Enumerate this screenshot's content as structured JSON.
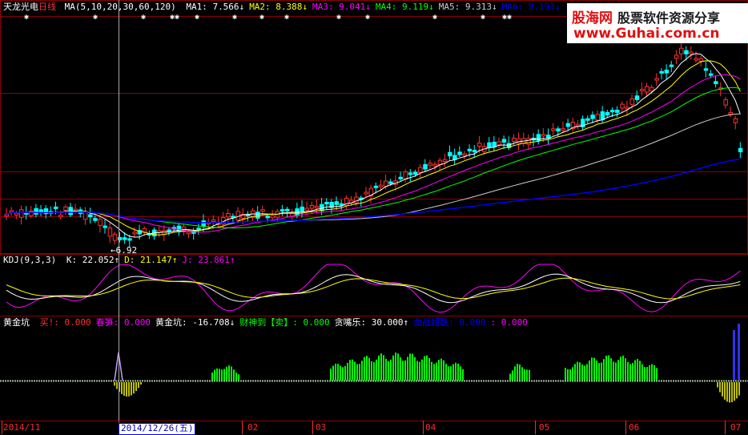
{
  "title": {
    "stock": "天龙光电",
    "period": "日线"
  },
  "ma_header": {
    "label": "MA(5,10,20,30,60,120)",
    "items": [
      {
        "name": "MA1",
        "value": "7.566",
        "arrow": "↓",
        "color": "#ffffff"
      },
      {
        "name": "MA2",
        "value": "8.388",
        "arrow": "↓",
        "color": "#ffff00"
      },
      {
        "name": "MA3",
        "value": "9.041",
        "arrow": "↓",
        "color": "#ff00ff"
      },
      {
        "name": "MA4",
        "value": "9.119",
        "arrow": "↓",
        "color": "#00ff00"
      },
      {
        "name": "MA5",
        "value": "9.313",
        "arrow": "↓",
        "color": "#cccccc"
      },
      {
        "name": "MA6",
        "value": "9.193",
        "arrow": "↓",
        "color": "#0000ff"
      }
    ]
  },
  "watermark": {
    "brand": "股海网",
    "tagline": "股票软件资源分享",
    "url": "www.Guhai.com.cn"
  },
  "low_marker": "6.92",
  "kdj_header": {
    "label": "KDJ(9,3,3)",
    "items": [
      {
        "name": "K",
        "value": "22.052",
        "arrow": "↑",
        "color": "#ffffff"
      },
      {
        "name": "D",
        "value": "21.147",
        "arrow": "↑",
        "color": "#ffff00"
      },
      {
        "name": "J",
        "value": "23.861",
        "arrow": "↑",
        "color": "#ff00ff"
      }
    ]
  },
  "gold_header": {
    "label": "黄金坑",
    "items": [
      {
        "name": "买!",
        "value": "0.000",
        "arrow": "",
        "color": "#ff3030"
      },
      {
        "name": "春笋",
        "value": "0.000",
        "arrow": "",
        "color": "#ff00ff"
      },
      {
        "name": "黄金坑",
        "value": "-16.708",
        "arrow": "↓",
        "color": "#ffffff"
      },
      {
        "name": "财神到【卖】",
        "value": "0.000",
        "arrow": "",
        "color": "#00ff00"
      },
      {
        "name": "贪嘴乐",
        "value": "30.000",
        "arrow": "↑",
        "color": "#ffffff"
      },
      {
        "name": "血战超跌",
        "value": "0.000",
        "arrow": "",
        "color": "#0000ff"
      },
      {
        "name": "",
        "value": "0.000",
        "arrow": "",
        "color": "#ff00ff"
      }
    ]
  },
  "x_axis": {
    "labels": [
      "2014/11",
      "02",
      "03",
      "04",
      "05",
      "06",
      "07"
    ],
    "cursor_date": "2014/12/26(五)"
  },
  "colors": {
    "up": "#ff3030",
    "down": "#00ffff",
    "grid": "#8b0000",
    "ma5": "#ffffff",
    "ma10": "#ffff00",
    "ma20": "#ff00ff",
    "ma30": "#00ff00",
    "ma60": "#cccccc",
    "ma120": "#0000ff"
  },
  "chart_data": [
    {
      "type": "candlestick",
      "title": "天龙光电 日线",
      "ylim": [
        6.5,
        15.5
      ],
      "x_labels": [
        "2014/11",
        "02",
        "03",
        "04",
        "05",
        "06",
        "07"
      ],
      "annotations": [
        "6.92"
      ]
    },
    {
      "type": "line",
      "title": "KDJ(9,3,3)",
      "series": [
        {
          "name": "K",
          "last": 22.052
        },
        {
          "name": "D",
          "last": 21.147
        },
        {
          "name": "J",
          "last": 23.861
        }
      ]
    },
    {
      "type": "bar",
      "title": "黄金坑",
      "series": [
        {
          "name": "黄金坑",
          "last": -16.708
        },
        {
          "name": "贪嘴乐",
          "last": 30.0
        }
      ]
    }
  ]
}
